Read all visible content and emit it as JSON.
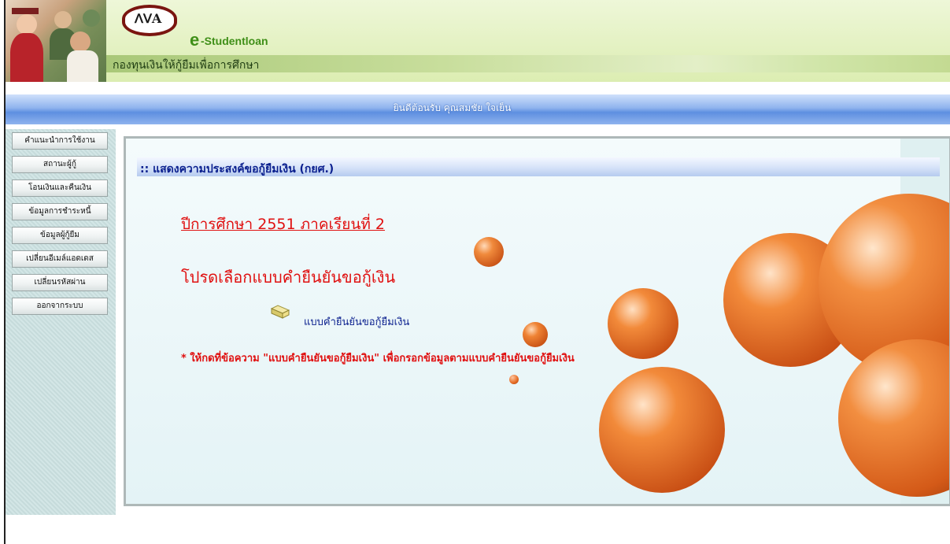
{
  "header": {
    "brand_e": "e",
    "brand_word": "-Studentloan",
    "fund_name": "กองทุนเงินให้กู้ยืมเพื่อการศึกษา"
  },
  "welcome_bar": {
    "text": "ยินดีต้อนรับ คุณสมชัย ใจเย็น"
  },
  "sidebar": {
    "items": [
      {
        "label": "คำแนะนำการใช้งาน"
      },
      {
        "label": "สถานะผู้กู้"
      },
      {
        "label": "โอนเงินและคืนเงิน"
      },
      {
        "label": "ข้อมูลการชำระหนี้"
      },
      {
        "label": "ข้อมูลผู้กู้ยืม"
      },
      {
        "label": "เปลี่ยนอีเมล์แอดเดส"
      },
      {
        "label": "เปลี่ยนรหัสผ่าน"
      },
      {
        "label": "ออกจากระบบ"
      }
    ]
  },
  "main": {
    "section_title": ":: แสดงความประสงค์ขอกู้ยืมเงิน (กยศ.)",
    "academic_year": "ปีการศึกษา 2551 ภาคเรียนที่ 2",
    "choose_form": "โปรดเลือกแบบคำยืนยันขอกู้เงิน",
    "form_link": "แบบคำยืนยันขอกู้ยืมเงิน",
    "note": "* ให้กดที่ข้อความ \"แบบคำยืนยันขอกู้ยืมเงิน\" เพื่อกรอกข้อมูลตามแบบคำยืนยันขอกู้ยืมเงิน"
  },
  "colors": {
    "accent_red": "#e01010",
    "link_blue": "#0a1f8e",
    "header_green": "#dcedb2",
    "sphere_orange": "#e8641a"
  },
  "icons": {
    "form_link_icon": "folder-icon"
  }
}
